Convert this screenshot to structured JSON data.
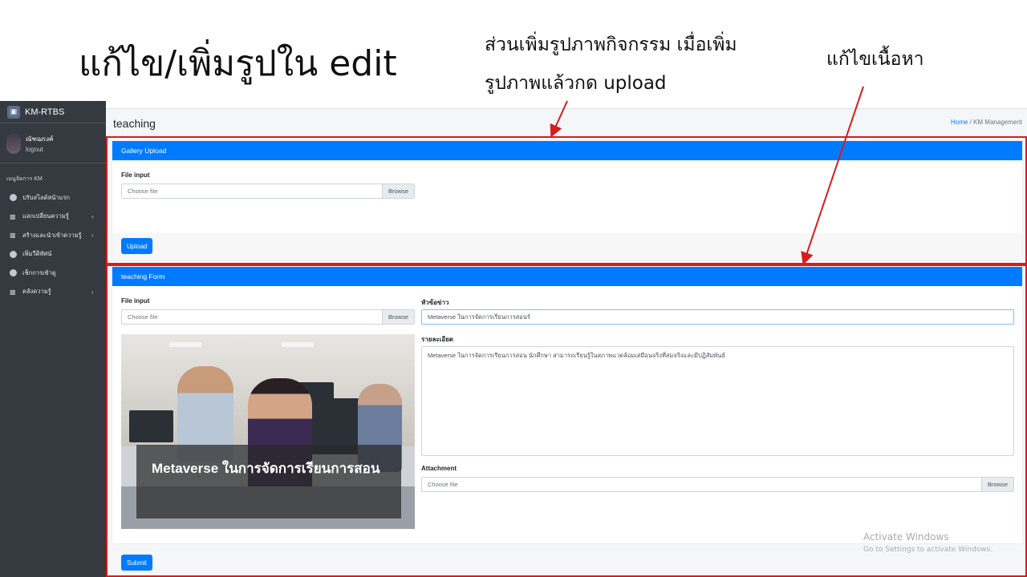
{
  "slide": {
    "title": "แก้ไข/เพิ่มรูปใน edit",
    "note_gallery": "ส่วนเพิ่มรูปภาพกิจกรรม เมื่อเพิ่มรูปภาพแล้วกด upload",
    "note_content": "แก้ไขเนื้อหา",
    "annotation_color": "#d81b1b"
  },
  "sidebar": {
    "brand": "KM-RTBS",
    "user_name": "ณัฑฌรงค์",
    "logout": "logout",
    "menu_header": "เมนูจัดการ KM",
    "items": [
      {
        "label": "ปรับสไลด์หน้าแรก",
        "icon": "circle-icon",
        "has_children": false
      },
      {
        "label": "แลกเปลี่ยนความรู้",
        "icon": "comments-icon",
        "has_children": true
      },
      {
        "label": "สร้างและนำเข้าความรู้",
        "icon": "comments-icon",
        "has_children": true
      },
      {
        "label": "เพิ่มวีดิทัศน์",
        "icon": "circle-icon",
        "has_children": false
      },
      {
        "label": "เช็กการเข้าดู",
        "icon": "circle-icon",
        "has_children": false
      },
      {
        "label": "คลังความรู้",
        "icon": "comments-icon",
        "has_children": true
      }
    ]
  },
  "header": {
    "page_title": "teaching",
    "breadcrumb_home": "Home",
    "breadcrumb_separator": "/",
    "breadcrumb_current": "KM Management"
  },
  "gallery": {
    "title": "Gallery Upload",
    "file_label": "File input",
    "file_placeholder": "Choose file",
    "browse": "Browse",
    "upload_button": "Upload"
  },
  "form": {
    "title": "teaching Form",
    "file_label": "File input",
    "file_placeholder": "Choose file",
    "browse": "Browse",
    "image_caption": "Metaverse ในการจัดการเรียนการสอน",
    "headline_label": "หัวข้อข่าว",
    "headline_value": "Metaverse ในการจัดการเรียนการสอนร์",
    "detail_label": "รายละเอียด",
    "detail_value": "Metaverse ในการจัดการเรียนการสอน นักศึกษา สามารถเรียนรู้ในสภาพแวดล้อมเสมือนจริงที่สมจริงและมีปฏิสัมพันธ์",
    "attachment_label": "Attachment",
    "attachment_placeholder": "Choose file",
    "attachment_browse": "Browse",
    "submit_button": "Submit"
  },
  "watermark": {
    "line1": "Activate Windows",
    "line2": "Go to Settings to activate Windows."
  },
  "colors": {
    "primary": "#007bff",
    "sidebar_bg": "#343a40",
    "content_bg": "#f4f6f9"
  }
}
